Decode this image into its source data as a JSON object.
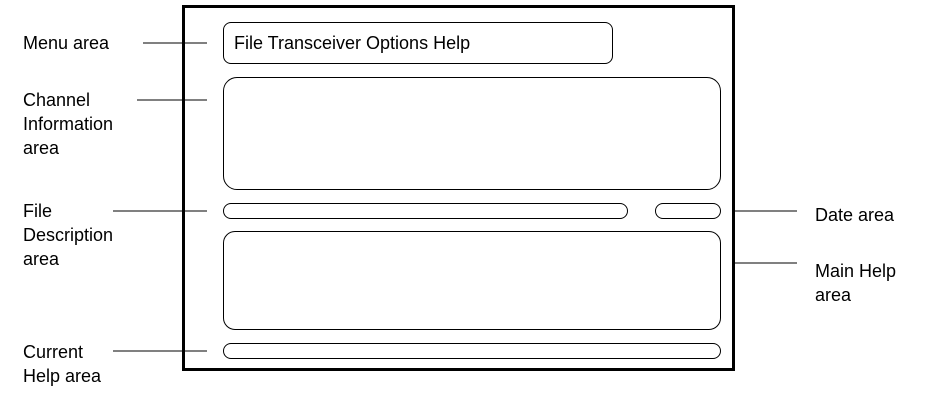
{
  "labels": {
    "menu_area": "Menu area",
    "channel_information_area": [
      "Channel",
      "Information",
      "area"
    ],
    "file_description_area": [
      "File",
      "Description",
      "area"
    ],
    "current_help_area": [
      "Current",
      "Help area"
    ],
    "date_area": "Date area",
    "main_help_area": [
      "Main Help",
      "area"
    ]
  },
  "menu_text": "File Transceiver Options Help"
}
